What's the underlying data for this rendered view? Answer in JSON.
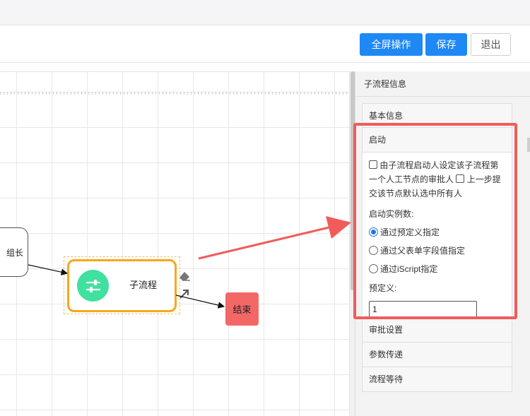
{
  "toolbar": {
    "fullscreen_label": "全屏操作",
    "save_label": "保存",
    "exit_label": "退出"
  },
  "canvas": {
    "partial_node_label": "组长",
    "subprocess_label": "子流程",
    "end_label": "结束"
  },
  "panel": {
    "title": "子流程信息",
    "sections": {
      "basic": "基本信息",
      "start": "启动",
      "approval": "审批设置",
      "params": "参数传递",
      "wait": "流程等待"
    },
    "start": {
      "checkbox1_label": "由子流程启动人设定该子流程第一个人工节点的审批人",
      "checkbox1_checked": false,
      "checkbox2_label": "上一步提交该节点默认选中所有人",
      "checkbox2_checked": false,
      "instances_label": "启动实例数:",
      "radio_options": [
        "通过预定义指定",
        "通过父表单字段值指定",
        "通过iScript指定"
      ],
      "radio_selected": "通过预定义指定",
      "predefined_label": "预定义:",
      "predefined_value": "1"
    }
  },
  "colors": {
    "primary": "#1e88f5",
    "subprocess_border": "#f5a81d",
    "subprocess_icon": "#3fe0a0",
    "end_node": "#f36767",
    "annotation": "#f25b5b"
  }
}
